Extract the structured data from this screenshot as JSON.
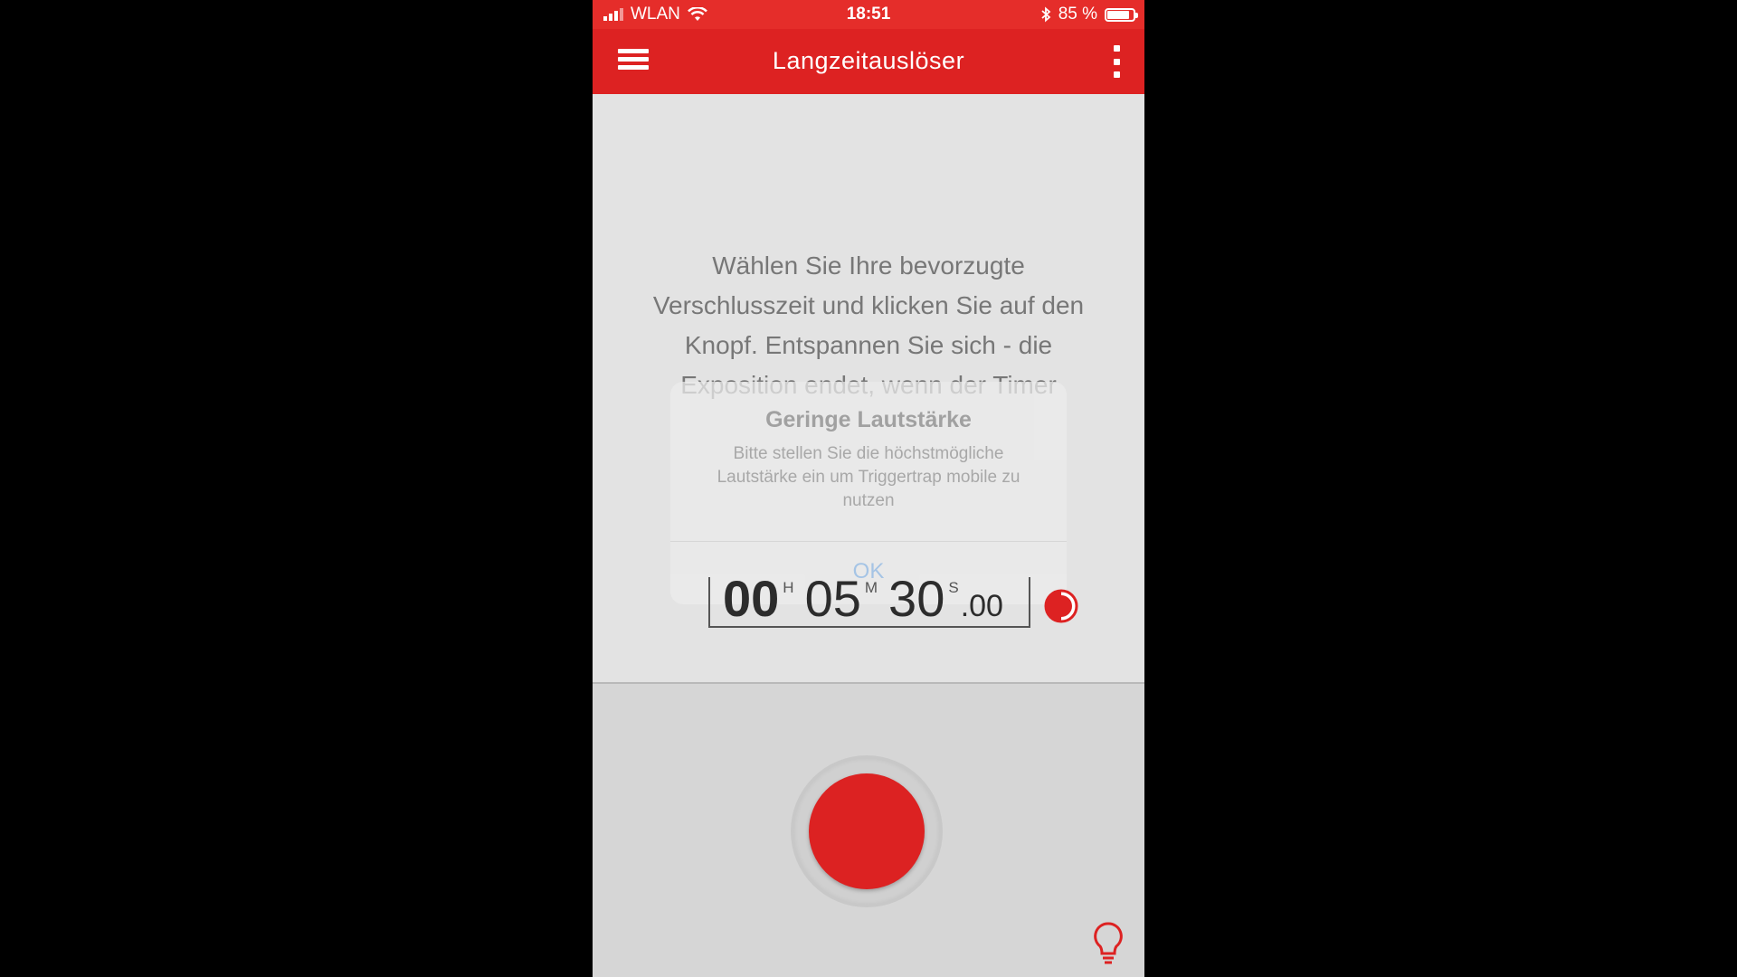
{
  "status_bar": {
    "carrier": "WLAN",
    "time": "18:51",
    "battery": "85 %",
    "battery_level": 0.85,
    "icons": [
      "signal-icon",
      "wifi-icon",
      "bluetooth-icon",
      "battery-icon"
    ]
  },
  "app_bar": {
    "title": "Langzeitauslöser",
    "menu_icon": "hamburger-menu-icon",
    "more_icon": "more-vertical-icon"
  },
  "main": {
    "instructions": "Wählen Sie Ihre bevorzugte Verschlusszeit und klicken Sie auf den Knopf. Entspannen Sie sich - die Exposition endet, wenn der Timer abgelaufen ist."
  },
  "alert": {
    "title": "Geringe Lautstärke",
    "message": "Bitte stellen Sie die höchstmögliche Lautstärke ein um Triggertrap mobile zu nutzen",
    "ok_label": "OK"
  },
  "timer": {
    "hours": "00",
    "hours_unit": "H",
    "minutes": "05",
    "minutes_unit": "M",
    "seconds": "30",
    "seconds_unit": "S",
    "fraction": ".00"
  },
  "colors": {
    "accent": "#dd2222",
    "status_bar": "#e52d2a",
    "background": "#e3e3e3",
    "bottom_panel": "#d6d6d6"
  },
  "icons": {
    "contrast": "half-circle-contrast-icon",
    "tip": "lightbulb-icon",
    "trigger": "record-button"
  }
}
